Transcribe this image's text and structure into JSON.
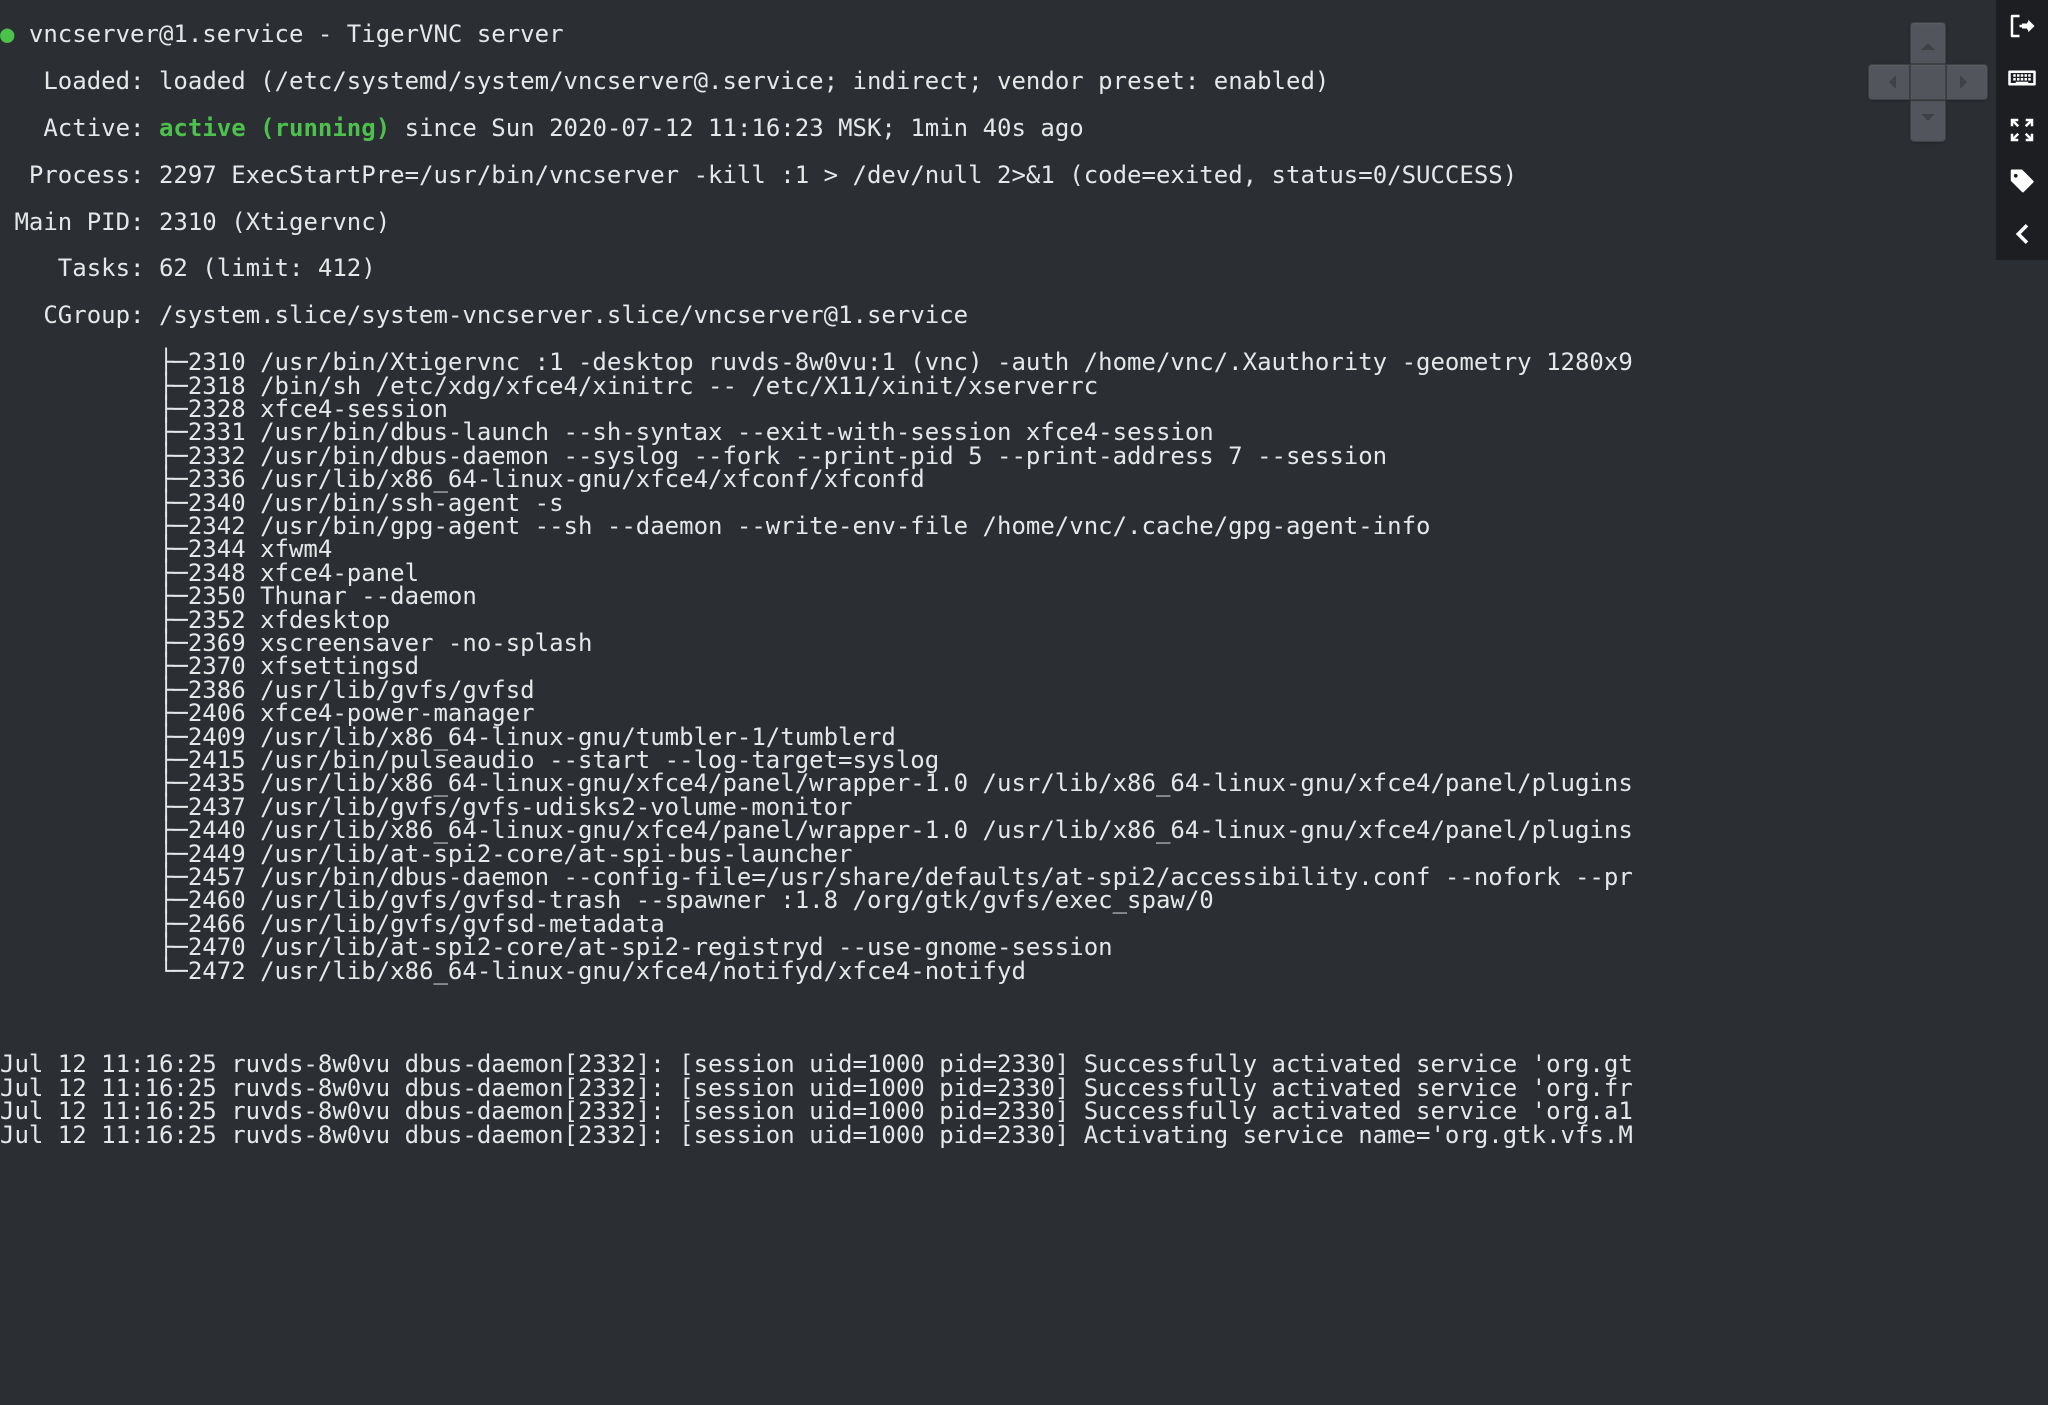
{
  "service": {
    "bullet": "●",
    "header": "vncserver@1.service - TigerVNC server",
    "loaded_key": "Loaded:",
    "loaded_val": "loaded (/etc/systemd/system/vncserver@.service; indirect; vendor preset: enabled)",
    "active_key": "Active:",
    "active_status": "active (running)",
    "active_rest": "since Sun 2020-07-12 11:16:23 MSK; 1min 40s ago",
    "process_key": "Process:",
    "process_val": "2297 ExecStartPre=/usr/bin/vncserver -kill :1 > /dev/null 2>&1 (code=exited, status=0/SUCCESS)",
    "mainpid_key": "Main PID:",
    "mainpid_val": "2310 (Xtigervnc)",
    "tasks_key": "Tasks:",
    "tasks_val": "62 (limit: 412)",
    "cgroup_key": "CGroup:",
    "cgroup_val": "/system.slice/system-vncserver.slice/vncserver@1.service"
  },
  "cgroup_tree": [
    {
      "prefix": "├─",
      "pid": "2310",
      "cmd": "/usr/bin/Xtigervnc :1 -desktop ruvds-8w0vu:1 (vnc) -auth /home/vnc/.Xauthority -geometry 1280x9"
    },
    {
      "prefix": "├─",
      "pid": "2318",
      "cmd": "/bin/sh /etc/xdg/xfce4/xinitrc -- /etc/X11/xinit/xserverrc"
    },
    {
      "prefix": "├─",
      "pid": "2328",
      "cmd": "xfce4-session"
    },
    {
      "prefix": "├─",
      "pid": "2331",
      "cmd": "/usr/bin/dbus-launch --sh-syntax --exit-with-session xfce4-session"
    },
    {
      "prefix": "├─",
      "pid": "2332",
      "cmd": "/usr/bin/dbus-daemon --syslog --fork --print-pid 5 --print-address 7 --session"
    },
    {
      "prefix": "├─",
      "pid": "2336",
      "cmd": "/usr/lib/x86_64-linux-gnu/xfce4/xfconf/xfconfd"
    },
    {
      "prefix": "├─",
      "pid": "2340",
      "cmd": "/usr/bin/ssh-agent -s"
    },
    {
      "prefix": "├─",
      "pid": "2342",
      "cmd": "/usr/bin/gpg-agent --sh --daemon --write-env-file /home/vnc/.cache/gpg-agent-info"
    },
    {
      "prefix": "├─",
      "pid": "2344",
      "cmd": "xfwm4"
    },
    {
      "prefix": "├─",
      "pid": "2348",
      "cmd": "xfce4-panel"
    },
    {
      "prefix": "├─",
      "pid": "2350",
      "cmd": "Thunar --daemon"
    },
    {
      "prefix": "├─",
      "pid": "2352",
      "cmd": "xfdesktop"
    },
    {
      "prefix": "├─",
      "pid": "2369",
      "cmd": "xscreensaver -no-splash"
    },
    {
      "prefix": "├─",
      "pid": "2370",
      "cmd": "xfsettingsd"
    },
    {
      "prefix": "├─",
      "pid": "2386",
      "cmd": "/usr/lib/gvfs/gvfsd"
    },
    {
      "prefix": "├─",
      "pid": "2406",
      "cmd": "xfce4-power-manager"
    },
    {
      "prefix": "├─",
      "pid": "2409",
      "cmd": "/usr/lib/x86_64-linux-gnu/tumbler-1/tumblerd"
    },
    {
      "prefix": "├─",
      "pid": "2415",
      "cmd": "/usr/bin/pulseaudio --start --log-target=syslog"
    },
    {
      "prefix": "├─",
      "pid": "2435",
      "cmd": "/usr/lib/x86_64-linux-gnu/xfce4/panel/wrapper-1.0 /usr/lib/x86_64-linux-gnu/xfce4/panel/plugins"
    },
    {
      "prefix": "├─",
      "pid": "2437",
      "cmd": "/usr/lib/gvfs/gvfs-udisks2-volume-monitor"
    },
    {
      "prefix": "├─",
      "pid": "2440",
      "cmd": "/usr/lib/x86_64-linux-gnu/xfce4/panel/wrapper-1.0 /usr/lib/x86_64-linux-gnu/xfce4/panel/plugins"
    },
    {
      "prefix": "├─",
      "pid": "2449",
      "cmd": "/usr/lib/at-spi2-core/at-spi-bus-launcher"
    },
    {
      "prefix": "├─",
      "pid": "2457",
      "cmd": "/usr/bin/dbus-daemon --config-file=/usr/share/defaults/at-spi2/accessibility.conf --nofork --pr"
    },
    {
      "prefix": "├─",
      "pid": "2460",
      "cmd": "/usr/lib/gvfs/gvfsd-trash --spawner :1.8 /org/gtk/gvfs/exec_spaw/0"
    },
    {
      "prefix": "├─",
      "pid": "2466",
      "cmd": "/usr/lib/gvfs/gvfsd-metadata"
    },
    {
      "prefix": "├─",
      "pid": "2470",
      "cmd": "/usr/lib/at-spi2-core/at-spi2-registryd --use-gnome-session"
    },
    {
      "prefix": "└─",
      "pid": "2472",
      "cmd": "/usr/lib/x86_64-linux-gnu/xfce4/notifyd/xfce4-notifyd"
    }
  ],
  "log_lines": [
    "Jul 12 11:16:25 ruvds-8w0vu dbus-daemon[2332]: [session uid=1000 pid=2330] Successfully activated service 'org.gt",
    "Jul 12 11:16:25 ruvds-8w0vu dbus-daemon[2332]: [session uid=1000 pid=2330] Successfully activated service 'org.fr",
    "Jul 12 11:16:25 ruvds-8w0vu dbus-daemon[2332]: [session uid=1000 pid=2330] Successfully activated service 'org.a1",
    "Jul 12 11:16:25 ruvds-8w0vu dbus-daemon[2332]: [session uid=1000 pid=2330] Activating service name='org.gtk.vfs.M"
  ],
  "toolbar": {
    "exit": "exit-icon",
    "keyboard": "keyboard-icon",
    "fullscreen": "fullscreen-icon",
    "tag": "tag-icon",
    "back": "chevron-left-icon"
  },
  "colors": {
    "bg": "#2b2e33",
    "fg": "#e6e7e8",
    "active": "#4cc24c"
  }
}
